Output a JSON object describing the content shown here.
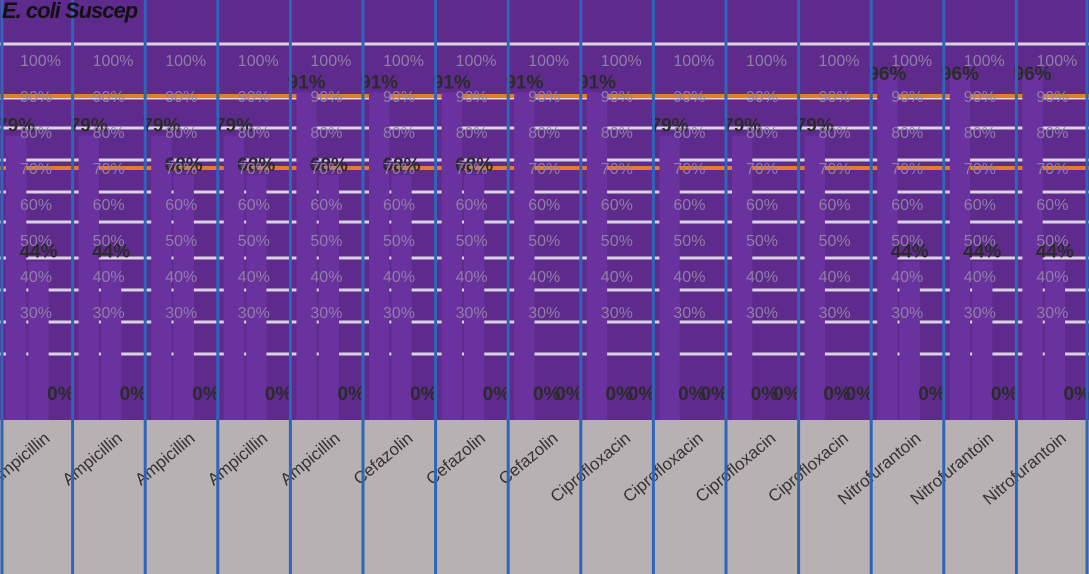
{
  "chart_data": {
    "type": "bar",
    "title": "E. coli Suscep",
    "ylabel": "",
    "xlabel": "",
    "ylim": [
      0,
      100
    ],
    "yticks": [
      "30%",
      "40%",
      "50%",
      "60%",
      "70%",
      "80%",
      "90%",
      "100%"
    ],
    "breakpoint_lines": [
      70,
      90
    ],
    "categories": [
      "Ampicillin",
      "Ampicillin",
      "Ampicillin",
      "Ampicillin",
      "Ampicillin",
      "Cefazolin",
      "Cefazolin",
      "Cefazolin",
      "Ciprofloxacin",
      "Ciprofloxacin",
      "Ciprofloxacin",
      "Ciprofloxacin",
      "Nitrofurantoin",
      "Nitrofurantoin",
      "Nitrofurantoin"
    ],
    "series": [
      {
        "values": [
          79,
          79,
          79,
          79,
          91,
          91,
          91,
          91,
          91,
          79,
          79,
          79,
          96,
          96,
          96
        ]
      },
      {
        "values": [
          44,
          44,
          68,
          68,
          68,
          68,
          68,
          0,
          0,
          0,
          0,
          0,
          44,
          44,
          44
        ]
      },
      {
        "values": [
          0,
          0,
          0,
          0,
          0,
          0,
          0,
          0,
          0,
          0,
          0,
          0,
          0,
          0,
          0
        ]
      }
    ],
    "grid": true,
    "legend": "none"
  },
  "colors": {
    "panel": "#5e2a8c",
    "bar": "#6a329e",
    "breakpoint": "#e87a2f",
    "border": "#2f64b8",
    "floor": "#b8b1b4"
  }
}
